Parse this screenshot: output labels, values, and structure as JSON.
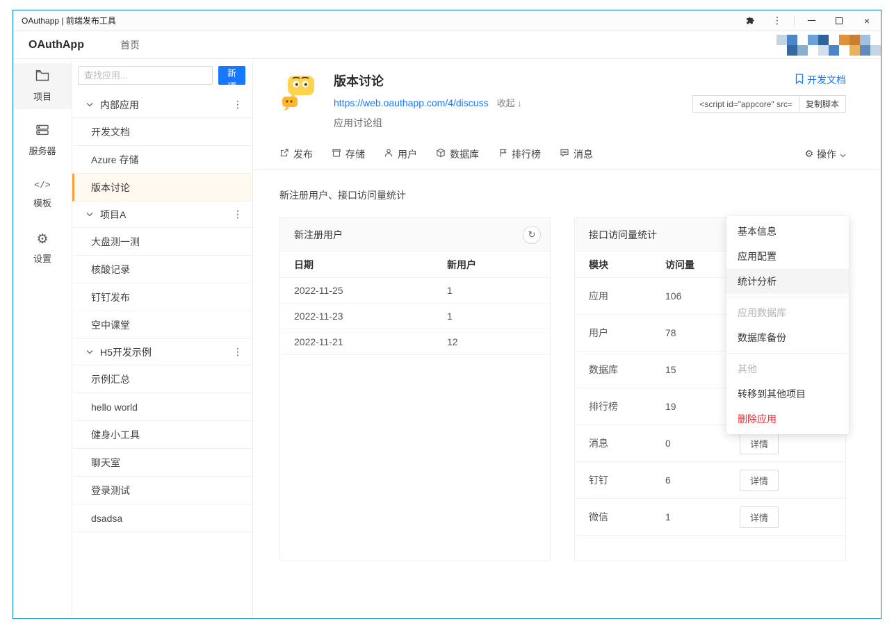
{
  "colors": {
    "accent": "#1677ff",
    "danger": "#f5222d",
    "selected": "#ffa13a",
    "window-border": "#0078d7"
  },
  "titlebar": {
    "title": "OAuthapp | 前端发布工具",
    "icons": [
      "extensions-icon",
      "kebab-menu-icon",
      "minimize-icon",
      "maximize-icon",
      "close-icon"
    ]
  },
  "nav": {
    "brand": "OAuthApp",
    "home": "首页"
  },
  "iconbar": [
    {
      "label": "项目",
      "icon": "folder-icon",
      "active": true
    },
    {
      "label": "服务器",
      "icon": "server-icon",
      "active": false
    },
    {
      "label": "模板",
      "icon": "code-icon",
      "active": false
    },
    {
      "label": "设置",
      "icon": "gear-icon",
      "active": false
    }
  ],
  "sidebar": {
    "search_placeholder": "查找应用...",
    "new_project_label": "新项目",
    "selected_item": "版本讨论",
    "groups": [
      {
        "label": "内部应用",
        "items": [
          "开发文档",
          "Azure 存储",
          "版本讨论"
        ]
      },
      {
        "label": "项目A",
        "items": [
          "大盘测一测",
          "核酸记录",
          "钉钉发布",
          "空中课堂"
        ]
      },
      {
        "label": "H5开发示例",
        "items": [
          "示例汇总",
          "hello world",
          "健身小工具",
          "聊天室",
          "登录测试",
          "dsadsa"
        ]
      }
    ]
  },
  "app": {
    "title": "版本讨论",
    "url": "https://web.oauthapp.com/4/discuss",
    "collapse_label": "收起 ↓",
    "subtitle": "应用讨论组",
    "doc_link_label": "开发文档",
    "script_snippet": "<script id=\"appcore\" src=",
    "copy_button_label": "复制脚本"
  },
  "tabs": [
    {
      "label": "发布",
      "icon": "external-link-icon"
    },
    {
      "label": "存储",
      "icon": "storage-icon"
    },
    {
      "label": "用户",
      "icon": "user-icon"
    },
    {
      "label": "数据库",
      "icon": "database-icon"
    },
    {
      "label": "排行榜",
      "icon": "ranking-icon"
    },
    {
      "label": "消息",
      "icon": "message-icon"
    }
  ],
  "actions": {
    "label": "操作",
    "icon": "gear-icon"
  },
  "caption": "新注册用户、接口访问量统计",
  "cards": {
    "new_users": {
      "title": "新注册用户",
      "columns": [
        "日期",
        "新用户"
      ],
      "rows": [
        [
          "2022-11-25",
          "1"
        ],
        [
          "2022-11-23",
          "1"
        ],
        [
          "2022-11-21",
          "12"
        ]
      ]
    },
    "api_stats": {
      "title": "接口访问量统计",
      "columns": [
        "模块",
        "访问量"
      ],
      "detail_label": "详情",
      "rows": [
        [
          "应用",
          "106"
        ],
        [
          "用户",
          "78"
        ],
        [
          "数据库",
          "15"
        ],
        [
          "排行榜",
          "19"
        ],
        [
          "消息",
          "0"
        ],
        [
          "钉钉",
          "6"
        ],
        [
          "微信",
          "1"
        ]
      ]
    }
  },
  "dropdown": {
    "items": [
      {
        "label": "基本信息",
        "type": "item"
      },
      {
        "label": "应用配置",
        "type": "item"
      },
      {
        "label": "统计分析",
        "type": "item",
        "hover": true
      },
      {
        "label": "应用数据库",
        "type": "section"
      },
      {
        "label": "数据库备份",
        "type": "item"
      },
      {
        "label": "其他",
        "type": "section"
      },
      {
        "label": "转移到其他项目",
        "type": "item"
      },
      {
        "label": "删除应用",
        "type": "item",
        "danger": true
      }
    ]
  }
}
